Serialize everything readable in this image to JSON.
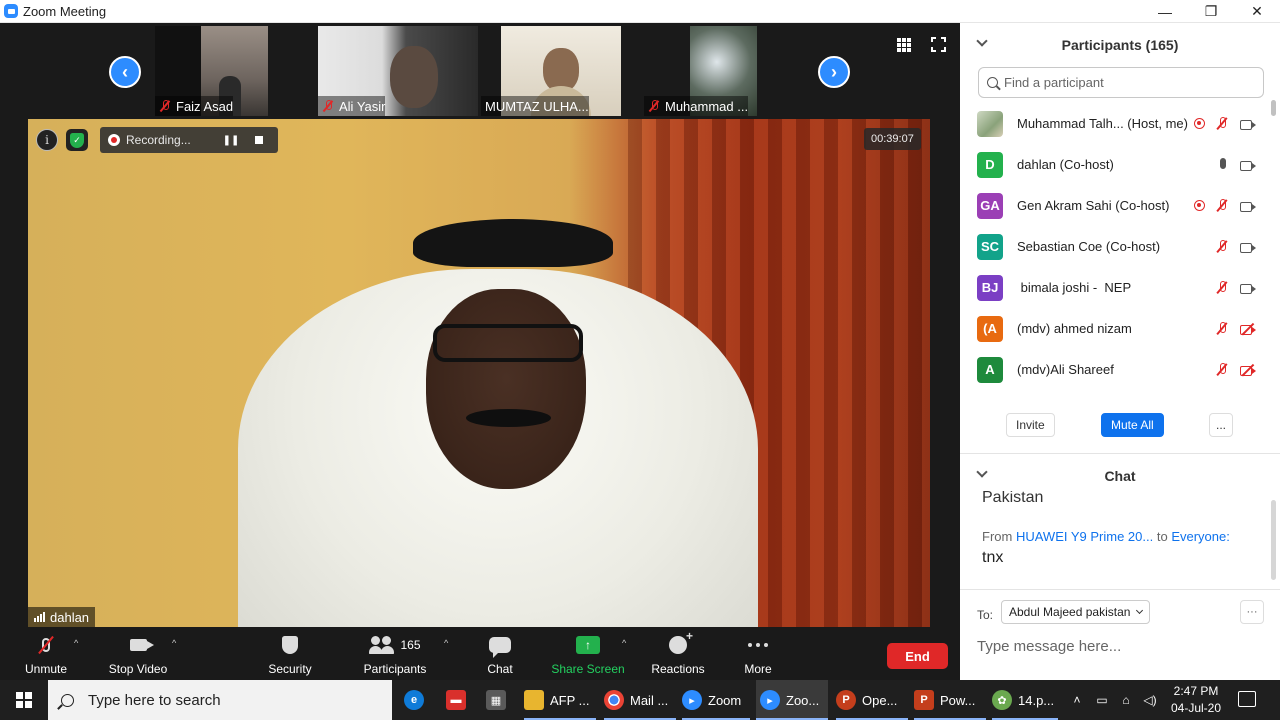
{
  "window": {
    "title": "Zoom Meeting",
    "controls": [
      "—",
      "❐",
      "✕"
    ]
  },
  "thumbnails": [
    {
      "name": "Faiz Asad",
      "muted": true
    },
    {
      "name": "Ali Yasir",
      "muted": true
    },
    {
      "name": "MUMTAZ ULHA...",
      "muted": false
    },
    {
      "name": "Muhammad ...",
      "muted": true
    }
  ],
  "main_video": {
    "speaker": "dahlan",
    "recording_label": "Recording...",
    "timer": "00:39:07"
  },
  "toolbar": {
    "unmute": "Unmute",
    "stop_video": "Stop Video",
    "security": "Security",
    "participants": "Participants",
    "participants_count": "165",
    "chat": "Chat",
    "share_screen": "Share Screen",
    "reactions": "Reactions",
    "more": "More",
    "end": "End"
  },
  "participants_panel": {
    "title": "Participants (165)",
    "search_placeholder": "Find a participant",
    "items": [
      {
        "initials": "",
        "name": "Muhammad Talh... (Host, me)",
        "color": "#8aa27a",
        "recording": true,
        "mic": "muted",
        "cam": "on"
      },
      {
        "initials": "D",
        "name": "dahlan (Co-host)",
        "color": "#23b14d",
        "recording": false,
        "mic": "on",
        "cam": "on"
      },
      {
        "initials": "GA",
        "name": "Gen Akram Sahi (Co-host)",
        "color": "#9b3fb5",
        "recording": true,
        "mic": "muted",
        "cam": "on"
      },
      {
        "initials": "SC",
        "name": "Sebastian Coe (Co-host)",
        "color": "#12a38a",
        "recording": false,
        "mic": "muted",
        "cam": "on"
      },
      {
        "initials": "BJ",
        "name": " bimala joshi -  NEP",
        "color": "#7b3fc4",
        "recording": false,
        "mic": "muted",
        "cam": "on"
      },
      {
        "initials": "(A",
        "name": "(mdv) ahmed nizam",
        "color": "#e86a10",
        "recording": false,
        "mic": "muted",
        "cam": "off"
      },
      {
        "initials": "A",
        "name": "(mdv)Ali Shareef",
        "color": "#1e8a3c",
        "recording": false,
        "mic": "muted",
        "cam": "off"
      }
    ],
    "invite": "Invite",
    "mute_all": "Mute All",
    "more": "..."
  },
  "chat_panel": {
    "title": "Chat",
    "prev_message_tail": "Pakistan",
    "message": {
      "from_label": "From",
      "sender": "HUAWEI Y9 Prime 20...",
      "to_label": "to",
      "recipient": "Everyone:",
      "text": "tnx"
    },
    "to_label": "To:",
    "to_value": "Abdul Majeed pakistan",
    "compose_placeholder": "Type message here...",
    "more": "···"
  },
  "taskbar": {
    "search_placeholder": "Type here to search",
    "apps": [
      {
        "label": "",
        "icon": "edge-icon",
        "color": "#0f7bd8"
      },
      {
        "label": "",
        "icon": "red-app-icon",
        "color": "#d9302c"
      },
      {
        "label": "",
        "icon": "store-icon",
        "color": "#5a5a5a"
      },
      {
        "label": "AFP ...",
        "icon": "folder-icon",
        "color": "#e8b52f"
      },
      {
        "label": "Mail ...",
        "icon": "chrome-icon",
        "color": "#3a8f3a"
      },
      {
        "label": "Zoom",
        "icon": "zoom-icon",
        "color": "#2d8cff"
      },
      {
        "label": "Zoo...",
        "icon": "zoom-icon",
        "color": "#2d8cff"
      },
      {
        "label": "Ope...",
        "icon": "powerpoint-icon",
        "color": "#c43e1c"
      },
      {
        "label": "Pow...",
        "icon": "powerpoint-doc-icon",
        "color": "#c43e1c"
      },
      {
        "label": "14.p...",
        "icon": "image-viewer-icon",
        "color": "#6aa84f"
      }
    ],
    "time": "2:47 PM",
    "date": "04-Jul-20"
  }
}
